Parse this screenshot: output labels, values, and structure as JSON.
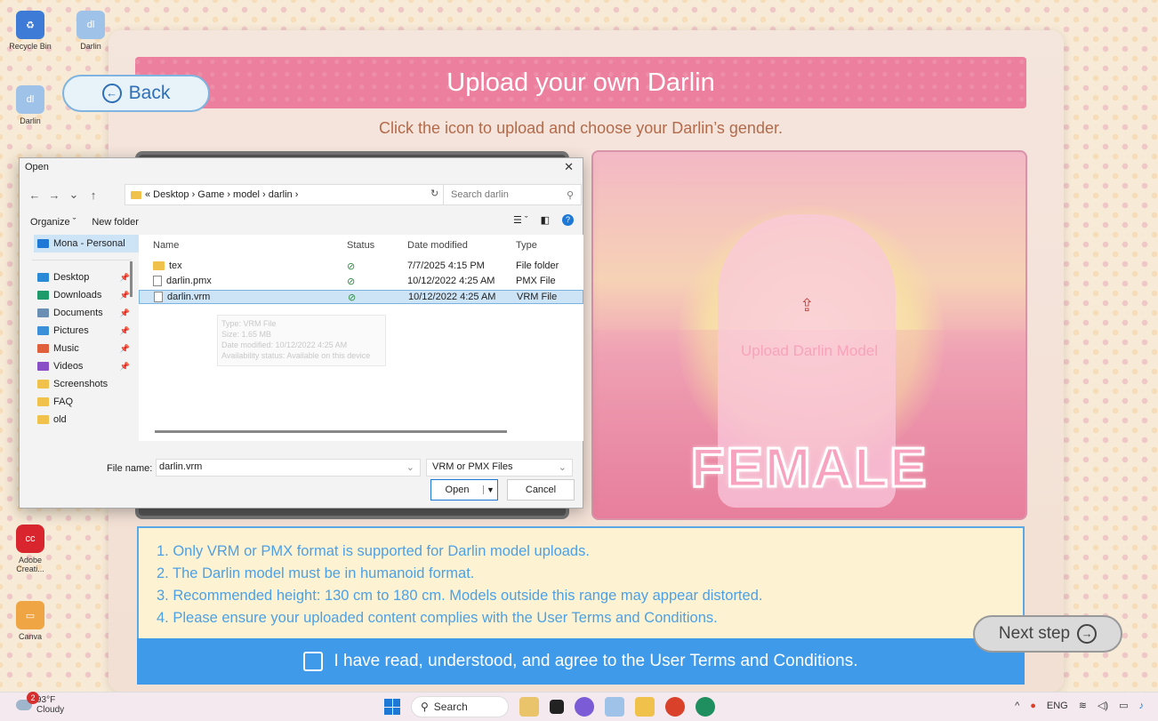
{
  "desktop": {
    "icons": [
      {
        "label": "Recycle Bin"
      },
      {
        "label": "Darlin"
      },
      {
        "label": "Darlin"
      },
      {
        "label": "Adobe Creati..."
      },
      {
        "label": "Canva"
      }
    ]
  },
  "app": {
    "back_label": "Back",
    "banner_title": "Upload your own Darlin",
    "subtitle": "Click the icon to upload and choose your Darlin’s gender.",
    "female_card": {
      "upload_label": "Upload Darlin Model",
      "gender_word": "FEMALE"
    },
    "notes": [
      "1. Only VRM or PMX format is supported for Darlin model uploads.",
      "2. The Darlin model must be in humanoid format.",
      "3. Recommended height: 130 cm to 180 cm. Models outside this range may appear distorted.",
      "4. Please ensure your uploaded content complies with the User Terms and Conditions."
    ],
    "agree_text": "I have read, understood, and agree to the User Terms and Conditions.",
    "next_label": "Next step"
  },
  "dialog": {
    "title": "Open",
    "address": "« Desktop › Game › model › darlin ›",
    "search_placeholder": "Search darlin",
    "organize_label": "Organize ˇ",
    "new_folder_label": "New folder",
    "nav": [
      {
        "label": "Mona - Personal"
      },
      {
        "label": "Desktop"
      },
      {
        "label": "Downloads"
      },
      {
        "label": "Documents"
      },
      {
        "label": "Pictures"
      },
      {
        "label": "Music"
      },
      {
        "label": "Videos"
      },
      {
        "label": "Screenshots"
      },
      {
        "label": "FAQ"
      },
      {
        "label": "old"
      }
    ],
    "columns": {
      "name": "Name",
      "status": "Status",
      "date": "Date modified",
      "type": "Type"
    },
    "files": [
      {
        "name": "tex",
        "date": "7/7/2025 4:15 PM",
        "type": "File folder"
      },
      {
        "name": "darlin.pmx",
        "date": "10/12/2022 4:25 AM",
        "type": "PMX File"
      },
      {
        "name": "darlin.vrm",
        "date": "10/12/2022 4:25 AM",
        "type": "VRM File"
      }
    ],
    "tooltip": [
      "Type: VRM File",
      "Size: 1.65 MB",
      "Date modified: 10/12/2022 4:25 AM",
      "Availability status: Available on this device"
    ],
    "filename_label": "File name:",
    "filename_value": "darlin.vrm",
    "filetype_value": "VRM or PMX Files",
    "open_label": "Open",
    "cancel_label": "Cancel"
  },
  "taskbar": {
    "weather_temp": "93°F",
    "weather_desc": "Cloudy",
    "notification_count": "2",
    "search_label": "Search",
    "lang": "ENG"
  }
}
